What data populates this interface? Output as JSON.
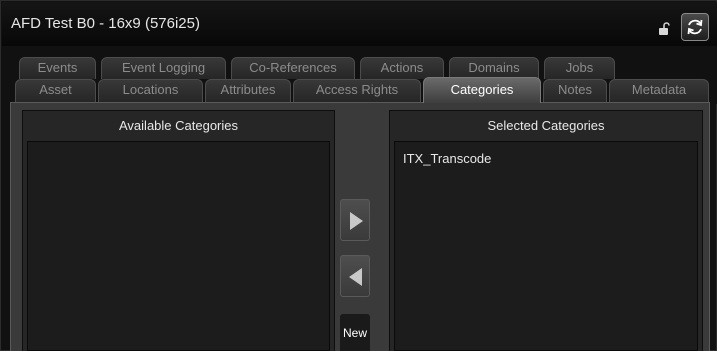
{
  "window": {
    "title": "AFD Test B0 - 16x9 (576i25)"
  },
  "tabs_row1": [
    {
      "label": "Events"
    },
    {
      "label": "Event Logging"
    },
    {
      "label": "Co-References"
    },
    {
      "label": "Actions"
    },
    {
      "label": "Domains"
    },
    {
      "label": "Jobs"
    }
  ],
  "tabs_row2": [
    {
      "label": "Asset"
    },
    {
      "label": "Locations"
    },
    {
      "label": "Attributes"
    },
    {
      "label": "Access Rights"
    },
    {
      "label": "Categories",
      "active": true
    },
    {
      "label": "Notes"
    },
    {
      "label": "Metadata"
    }
  ],
  "available": {
    "header": "Available Categories",
    "items": []
  },
  "selected": {
    "header": "Selected Categories",
    "items": [
      "ITX_Transcode"
    ]
  },
  "controls": {
    "new_label": "New"
  },
  "colors": {
    "active_tab": "#5a5a5a",
    "panel_bg": "#262626",
    "list_bg": "#1c1c1c"
  }
}
